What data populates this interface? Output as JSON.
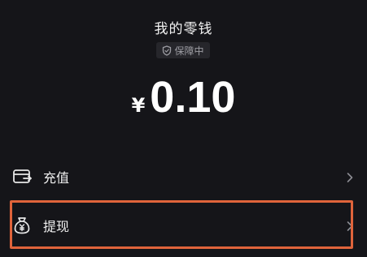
{
  "header": {
    "title": "我的零钱",
    "badge_label": "保障中"
  },
  "balance": {
    "currency_symbol": "¥",
    "amount": "0.10"
  },
  "menu": {
    "items": [
      {
        "label": "充值",
        "icon": "wallet-card-icon"
      },
      {
        "label": "提现",
        "icon": "money-bag-icon"
      }
    ]
  },
  "colors": {
    "background": "#151519",
    "highlight_border": "#e0643b",
    "badge_background": "#26262b"
  }
}
